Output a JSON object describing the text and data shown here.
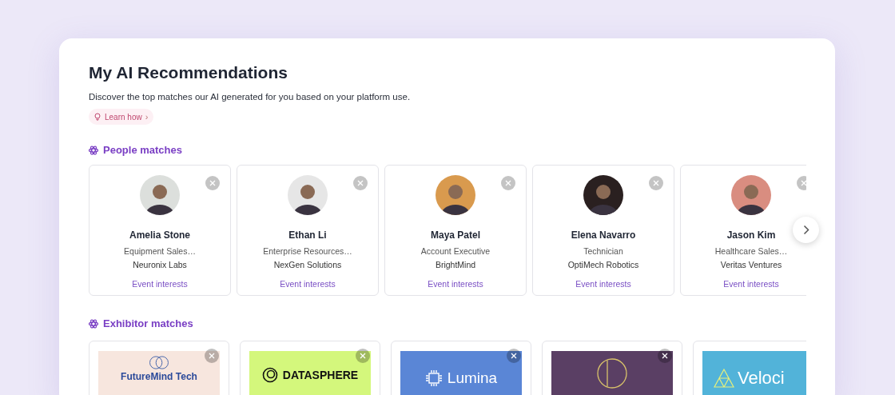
{
  "title": "My AI Recommendations",
  "subtitle": "Discover the top matches our AI generated for you based on your platform use.",
  "learn_link": {
    "label": "Learn how",
    "chevron": "›"
  },
  "people_section": {
    "heading": "People matches",
    "people": [
      {
        "name": "Amelia Stone",
        "role": "Equipment Sales…",
        "company": "Neuronix Labs",
        "link": "Event interests",
        "color": "#dcdfdc"
      },
      {
        "name": "Ethan Li",
        "role": "Enterprise Resources…",
        "company": "NexGen Solutions",
        "link": "Event interests",
        "color": "#e6e6e6"
      },
      {
        "name": "Maya Patel",
        "role": "Account Executive",
        "company": "BrightMind",
        "link": "Event interests",
        "color": "#d99a4e"
      },
      {
        "name": "Elena Navarro",
        "role": "Technician",
        "company": "OptiMech Robotics",
        "link": "Event interests",
        "color": "#2a2020"
      },
      {
        "name": "Jason Kim",
        "role": "Healthcare Sales…",
        "company": "Veritas Ventures",
        "link": "Event interests",
        "color": "#d98d80"
      }
    ]
  },
  "exhibitor_section": {
    "heading": "Exhibitor matches",
    "exhibitors": [
      {
        "kind": "rings",
        "logo_text": "FutureMind Tech",
        "color": "#f7e6de"
      },
      {
        "kind": "sphere",
        "logo_text": "DATASPHERE",
        "color": "#d4f77c"
      },
      {
        "kind": "chip",
        "logo_text": "Lumina",
        "color": "#5a86d6"
      },
      {
        "kind": "ring",
        "color": "#5a3f64"
      },
      {
        "kind": "triangle",
        "logo_text": "Veloci",
        "color": "#52b3d9"
      }
    ]
  }
}
